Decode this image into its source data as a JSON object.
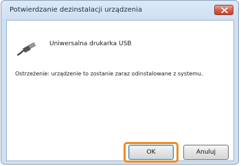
{
  "window": {
    "title": "Potwierdzanie dezinstalacji urządzenia",
    "close_icon": "close-x-icon"
  },
  "device": {
    "icon": "usb-cable-icon",
    "name": "Uniwersalna drukarka USB"
  },
  "message": {
    "warning": "Ostrzeżenie: urządzenie to zostanie zaraz odinstalowane z systemu."
  },
  "buttons": {
    "ok_label": "OK",
    "cancel_label": "Anuluj"
  },
  "colors": {
    "highlight": "#f08a1c",
    "close_button": "#d5604d"
  }
}
